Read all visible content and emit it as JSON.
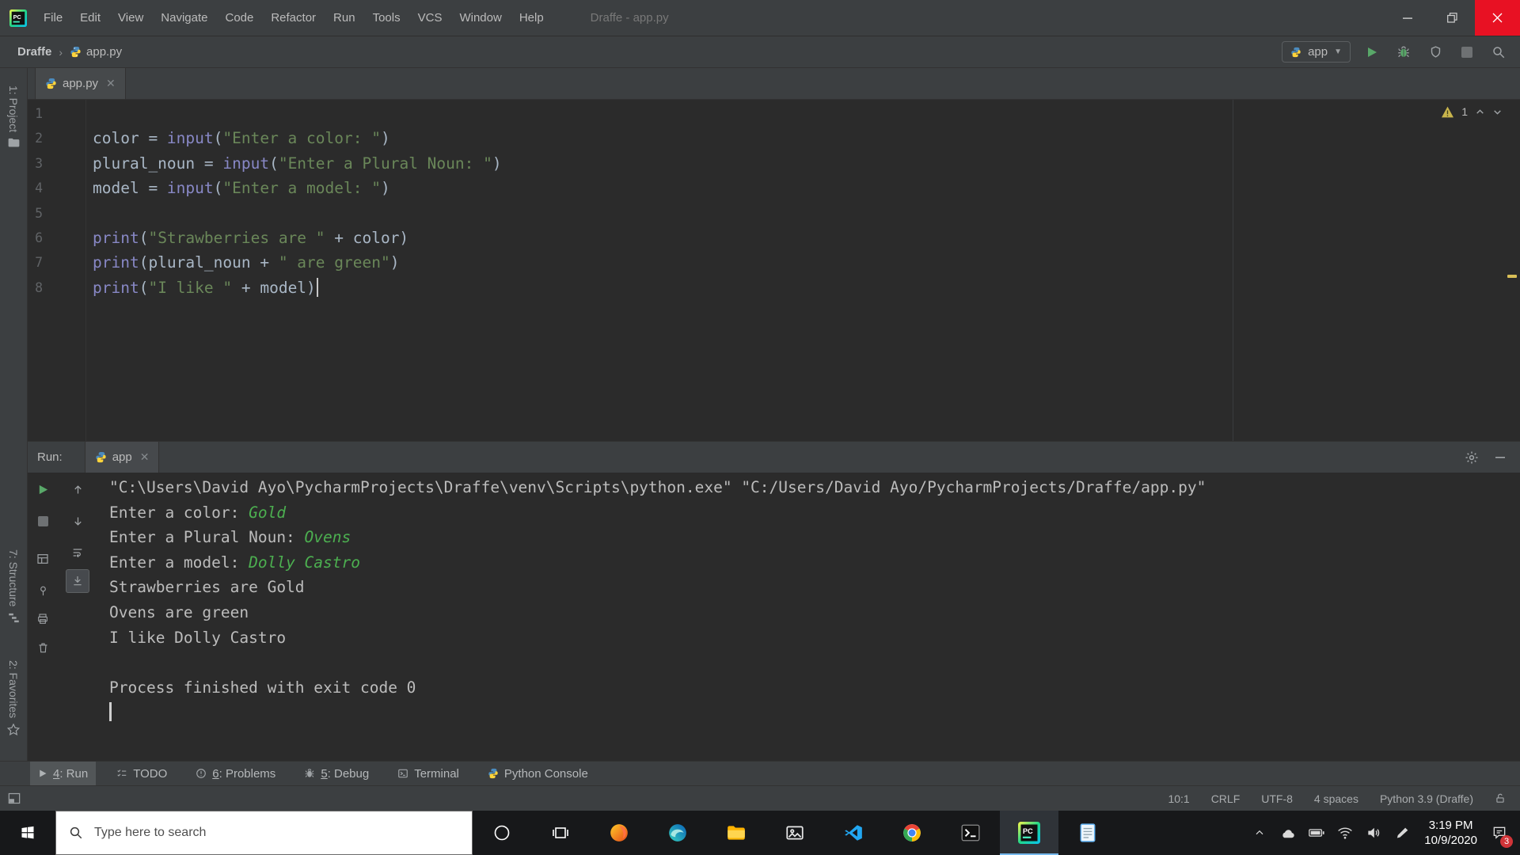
{
  "titlebar": {
    "menus": [
      "File",
      "Edit",
      "View",
      "Navigate",
      "Code",
      "Refactor",
      "Run",
      "Tools",
      "VCS",
      "Window",
      "Help"
    ],
    "title": "Draffe - app.py"
  },
  "navbar": {
    "project": "Draffe",
    "file": "app.py",
    "run_config": "app"
  },
  "stripes": {
    "project": "1: Project",
    "structure": "7: Structure",
    "favorites": "2: Favorites"
  },
  "editor": {
    "tab": "app.py",
    "warning_count": "1",
    "lines": [
      {
        "n": "1",
        "seg": []
      },
      {
        "n": "2",
        "seg": [
          [
            "color = ",
            "p"
          ],
          [
            "input",
            "b"
          ],
          [
            "(",
            "p"
          ],
          [
            "\"Enter a color: \"",
            "s"
          ],
          [
            ")",
            "p"
          ]
        ]
      },
      {
        "n": "3",
        "seg": [
          [
            "plural_noun = ",
            "p"
          ],
          [
            "input",
            "b"
          ],
          [
            "(",
            "p"
          ],
          [
            "\"Enter a Plural Noun: \"",
            "s"
          ],
          [
            ")",
            "p"
          ]
        ]
      },
      {
        "n": "4",
        "seg": [
          [
            "model = ",
            "p"
          ],
          [
            "input",
            "b"
          ],
          [
            "(",
            "p"
          ],
          [
            "\"Enter a model: \"",
            "s"
          ],
          [
            ")",
            "p"
          ]
        ]
      },
      {
        "n": "5",
        "seg": []
      },
      {
        "n": "6",
        "seg": [
          [
            "print",
            "b"
          ],
          [
            "(",
            "p"
          ],
          [
            "\"Strawberries are \"",
            "s"
          ],
          [
            " + color)",
            "p"
          ]
        ]
      },
      {
        "n": "7",
        "seg": [
          [
            "print",
            "b"
          ],
          [
            "(plural_noun + ",
            "p"
          ],
          [
            "\" are green\"",
            "s"
          ],
          [
            ")",
            "p"
          ]
        ]
      },
      {
        "n": "8",
        "seg": [
          [
            "print",
            "b"
          ],
          [
            "(",
            "p"
          ],
          [
            "\"I like \"",
            "s"
          ],
          [
            " + model)",
            "p"
          ]
        ],
        "caret": true
      }
    ]
  },
  "run_panel": {
    "label": "Run:",
    "tab": "app",
    "console": [
      {
        "seg": [
          [
            "\"C:\\Users\\David Ayo\\PycharmProjects\\Draffe\\venv\\Scripts\\python.exe\" \"C:/Users/David Ayo/PycharmProjects/Draffe/app.py\"",
            "o"
          ]
        ]
      },
      {
        "seg": [
          [
            "Enter a color: ",
            "o"
          ],
          [
            "Gold",
            "i"
          ]
        ]
      },
      {
        "seg": [
          [
            "Enter a Plural Noun: ",
            "o"
          ],
          [
            "Ovens",
            "i"
          ]
        ]
      },
      {
        "seg": [
          [
            "Enter a model: ",
            "o"
          ],
          [
            "Dolly Castro",
            "i"
          ]
        ]
      },
      {
        "seg": [
          [
            "Strawberries are Gold",
            "o"
          ]
        ]
      },
      {
        "seg": [
          [
            "Ovens are green",
            "o"
          ]
        ]
      },
      {
        "seg": [
          [
            "I like Dolly Castro",
            "o"
          ]
        ]
      },
      {
        "seg": []
      },
      {
        "seg": [
          [
            "Process finished with exit code 0",
            "o"
          ]
        ]
      },
      {
        "seg": [],
        "caret": true
      }
    ]
  },
  "bottom_bar": {
    "items": [
      {
        "pre": "4",
        "label": ": Run"
      },
      {
        "pre": "",
        "label": "TODO"
      },
      {
        "pre": "6",
        "label": ": Problems"
      },
      {
        "pre": "5",
        "label": ": Debug"
      },
      {
        "pre": "",
        "label": "Terminal"
      },
      {
        "pre": "",
        "label": "Python Console"
      }
    ]
  },
  "statusbar": {
    "caret": "10:1",
    "line_sep": "CRLF",
    "encoding": "UTF-8",
    "indent": "4 spaces",
    "interpreter": "Python 3.9 (Draffe)"
  },
  "taskbar": {
    "search_placeholder": "Type here to search",
    "time": "3:19 PM",
    "date": "10/9/2020",
    "badge": "3"
  }
}
